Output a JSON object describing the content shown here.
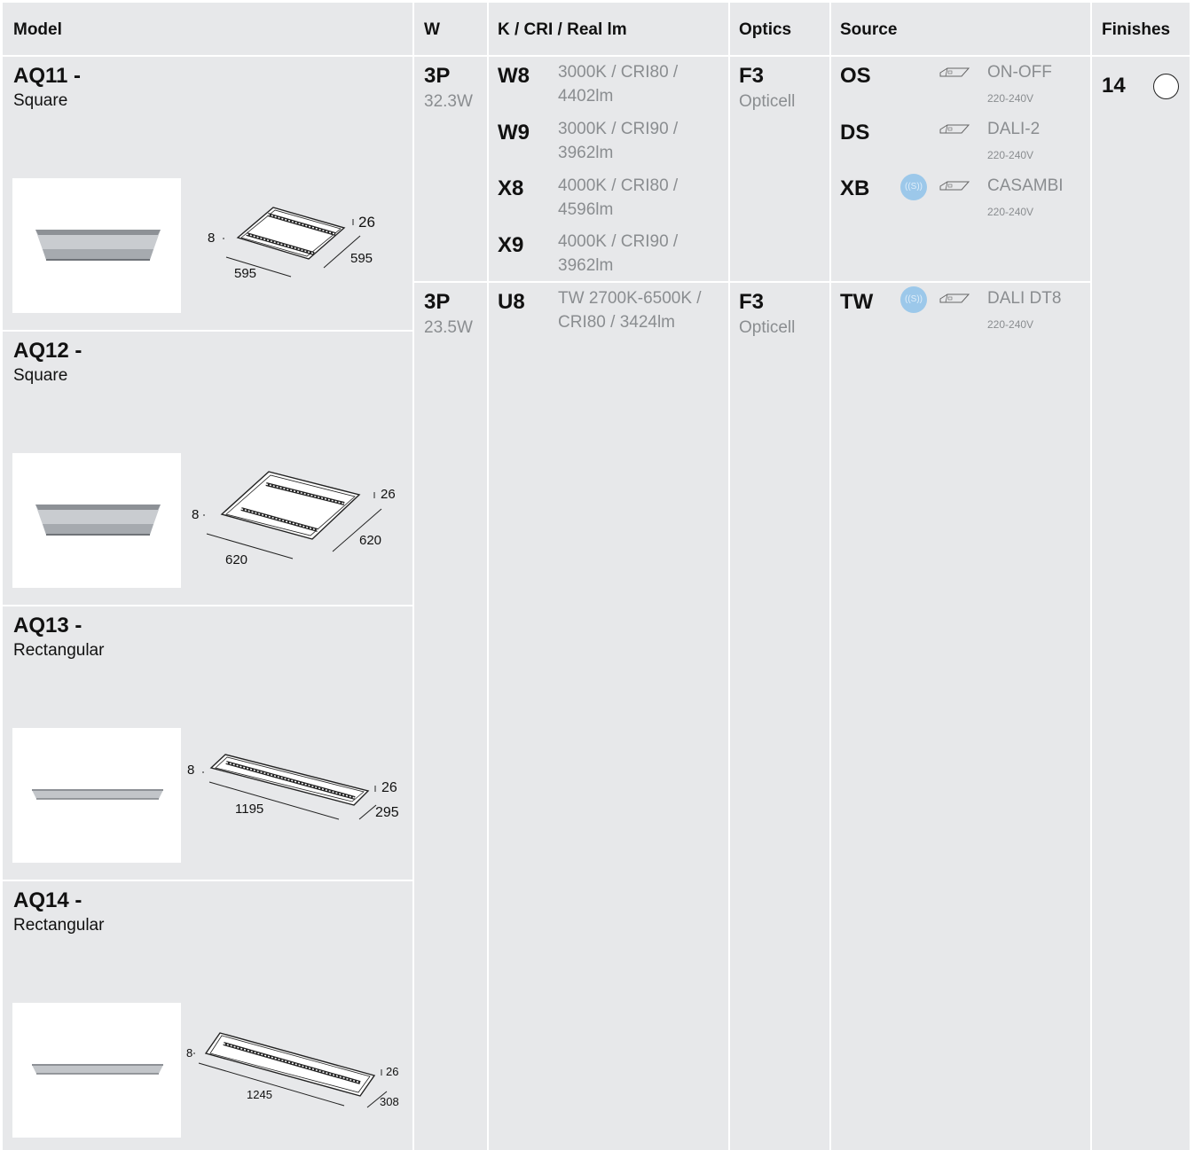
{
  "header": {
    "model": "Model",
    "w": "W",
    "kcri": "K / CRI / Real lm",
    "optics": "Optics",
    "source": "Source",
    "finishes": "Finishes"
  },
  "models": [
    {
      "code": "AQ11 -",
      "shape": "Square",
      "dims": {
        "a": "8",
        "b": "26",
        "c": "595",
        "d": "595"
      }
    },
    {
      "code": "AQ12 -",
      "shape": "Square",
      "dims": {
        "a": "8",
        "b": "26",
        "c": "620",
        "d": "620"
      }
    },
    {
      "code": "AQ13 -",
      "shape": "Rectangular",
      "dims": {
        "a": "8",
        "b": "26",
        "c": "1195",
        "d": "295"
      }
    },
    {
      "code": "AQ14 -",
      "shape": "Rectangular",
      "dims": {
        "a": "8",
        "b": "26",
        "c": "1245",
        "d": "308"
      }
    }
  ],
  "groups": [
    {
      "power_code": "3P",
      "power": "32.3W",
      "variants": [
        {
          "code": "W8",
          "spec": "3000K / CRI80 / 4402lm"
        },
        {
          "code": "W9",
          "spec": "3000K / CRI90 / 3962lm"
        },
        {
          "code": "X8",
          "spec": "4000K / CRI80 / 4596lm"
        },
        {
          "code": "X9",
          "spec": "4000K / CRI90 / 3962lm"
        }
      ],
      "optics_code": "F3",
      "optics_name": "Opticell",
      "sources": [
        {
          "code": "OS",
          "name": "ON-OFF",
          "voltage": "220-240V",
          "icon": "driver-icon"
        },
        {
          "code": "DS",
          "name": "DALI-2",
          "voltage": "220-240V",
          "icon": "driver-icon"
        },
        {
          "code": "XB",
          "name": "CASAMBI",
          "voltage": "220-240V",
          "icon": "driver-icon",
          "badge": "casambi-icon"
        }
      ]
    },
    {
      "power_code": "3P",
      "power": "23.5W",
      "variants": [
        {
          "code": "U8",
          "spec": "TW 2700K-6500K / CRI80 / 3424lm"
        }
      ],
      "optics_code": "F3",
      "optics_name": "Opticell",
      "sources": [
        {
          "code": "TW",
          "name": "DALI DT8",
          "voltage": "220-240V",
          "icon": "driver-icon",
          "badge": "casambi-icon"
        }
      ]
    }
  ],
  "finishes": {
    "code": "14",
    "swatch_color": "#ffffff"
  },
  "colors": {
    "cell": "#e7e8ea",
    "casambi": "#9cc8ea",
    "muted_text": "#8a8d90"
  }
}
